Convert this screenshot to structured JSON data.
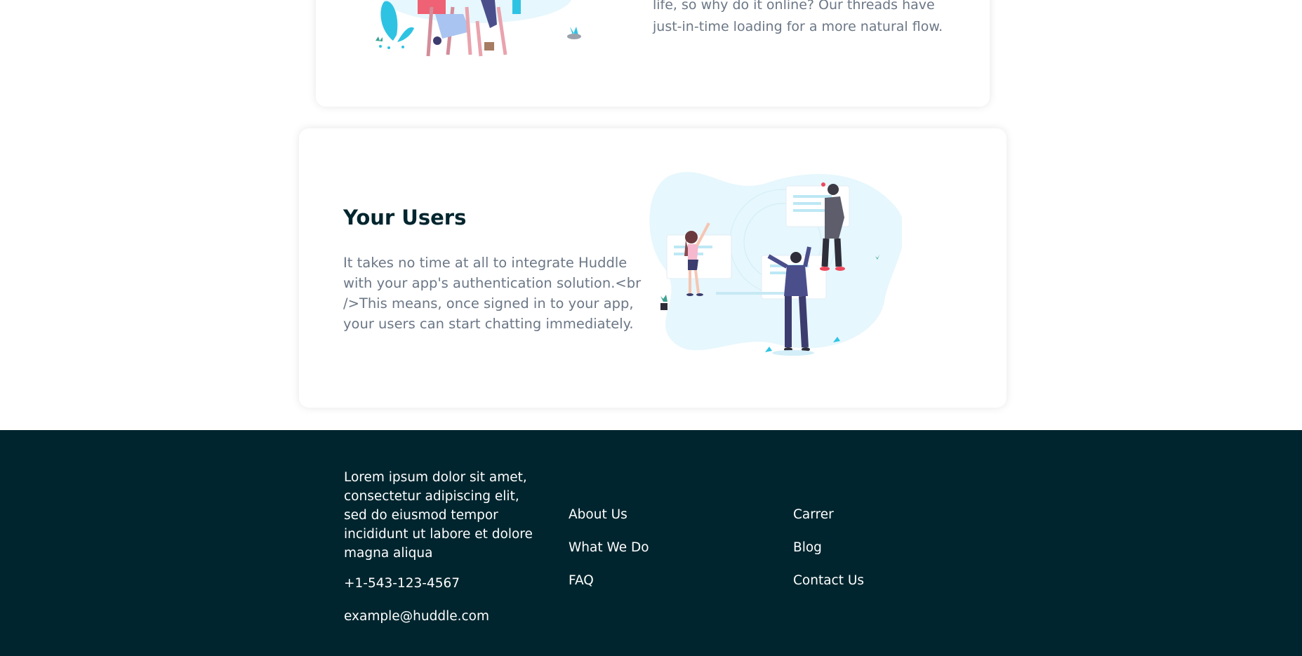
{
  "top_section": {
    "text": "life, so why do it online? Our threads have just-in-time loading for a more natural flow."
  },
  "users_section": {
    "title": "Your Users",
    "description": "It takes no time at all to integrate Huddle with your app's authentication solution.<br />This means, once signed in to your app, your users can start chatting immediately."
  },
  "footer": {
    "about": "Lorem ipsum dolor sit amet, consectetur adipiscing elit, sed do eiusmod tempor incididunt ut labore et dolore magna aliqua",
    "phone": "+1-543-123-4567",
    "email": "example@huddle.com",
    "links_col1": [
      "About Us",
      "What We Do",
      "FAQ"
    ],
    "links_col2": [
      "Carrer",
      "Blog",
      "Contact Us"
    ]
  },
  "colors": {
    "footer_bg": "#00252e",
    "heading": "#00252e",
    "body_text": "#6b7786",
    "accent_cyan": "#2fc3e3"
  }
}
